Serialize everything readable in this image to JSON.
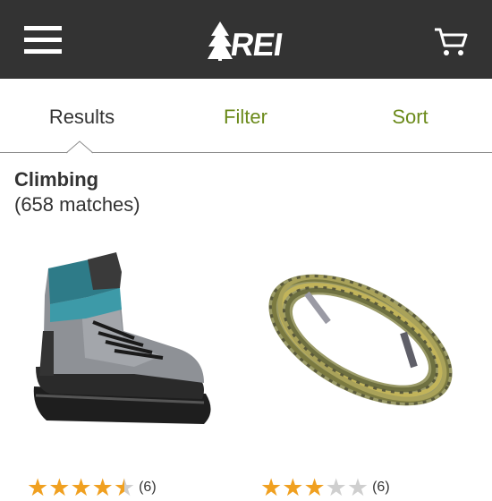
{
  "header": {
    "menu_icon": "hamburger-menu-icon",
    "logo_text": "REI",
    "cart_icon": "shopping-cart-icon",
    "background_color": "#333333"
  },
  "tabs": [
    {
      "label": "Results",
      "selected": true
    },
    {
      "label": "Filter",
      "selected": false
    },
    {
      "label": "Sort",
      "selected": false
    }
  ],
  "tab_colors": {
    "selected": "#333333",
    "action": "#6b8a1a"
  },
  "category": {
    "title": "Climbing",
    "matches": "(658 matches)"
  },
  "products": [
    {
      "image": "mountaineering-boot-image",
      "rating": 4.5,
      "rating_max": 5,
      "reviews": "(6)"
    },
    {
      "image": "climbing-rope-image",
      "rating": 3,
      "rating_max": 5,
      "reviews": "(6)"
    }
  ],
  "star_color": "#f0a020"
}
